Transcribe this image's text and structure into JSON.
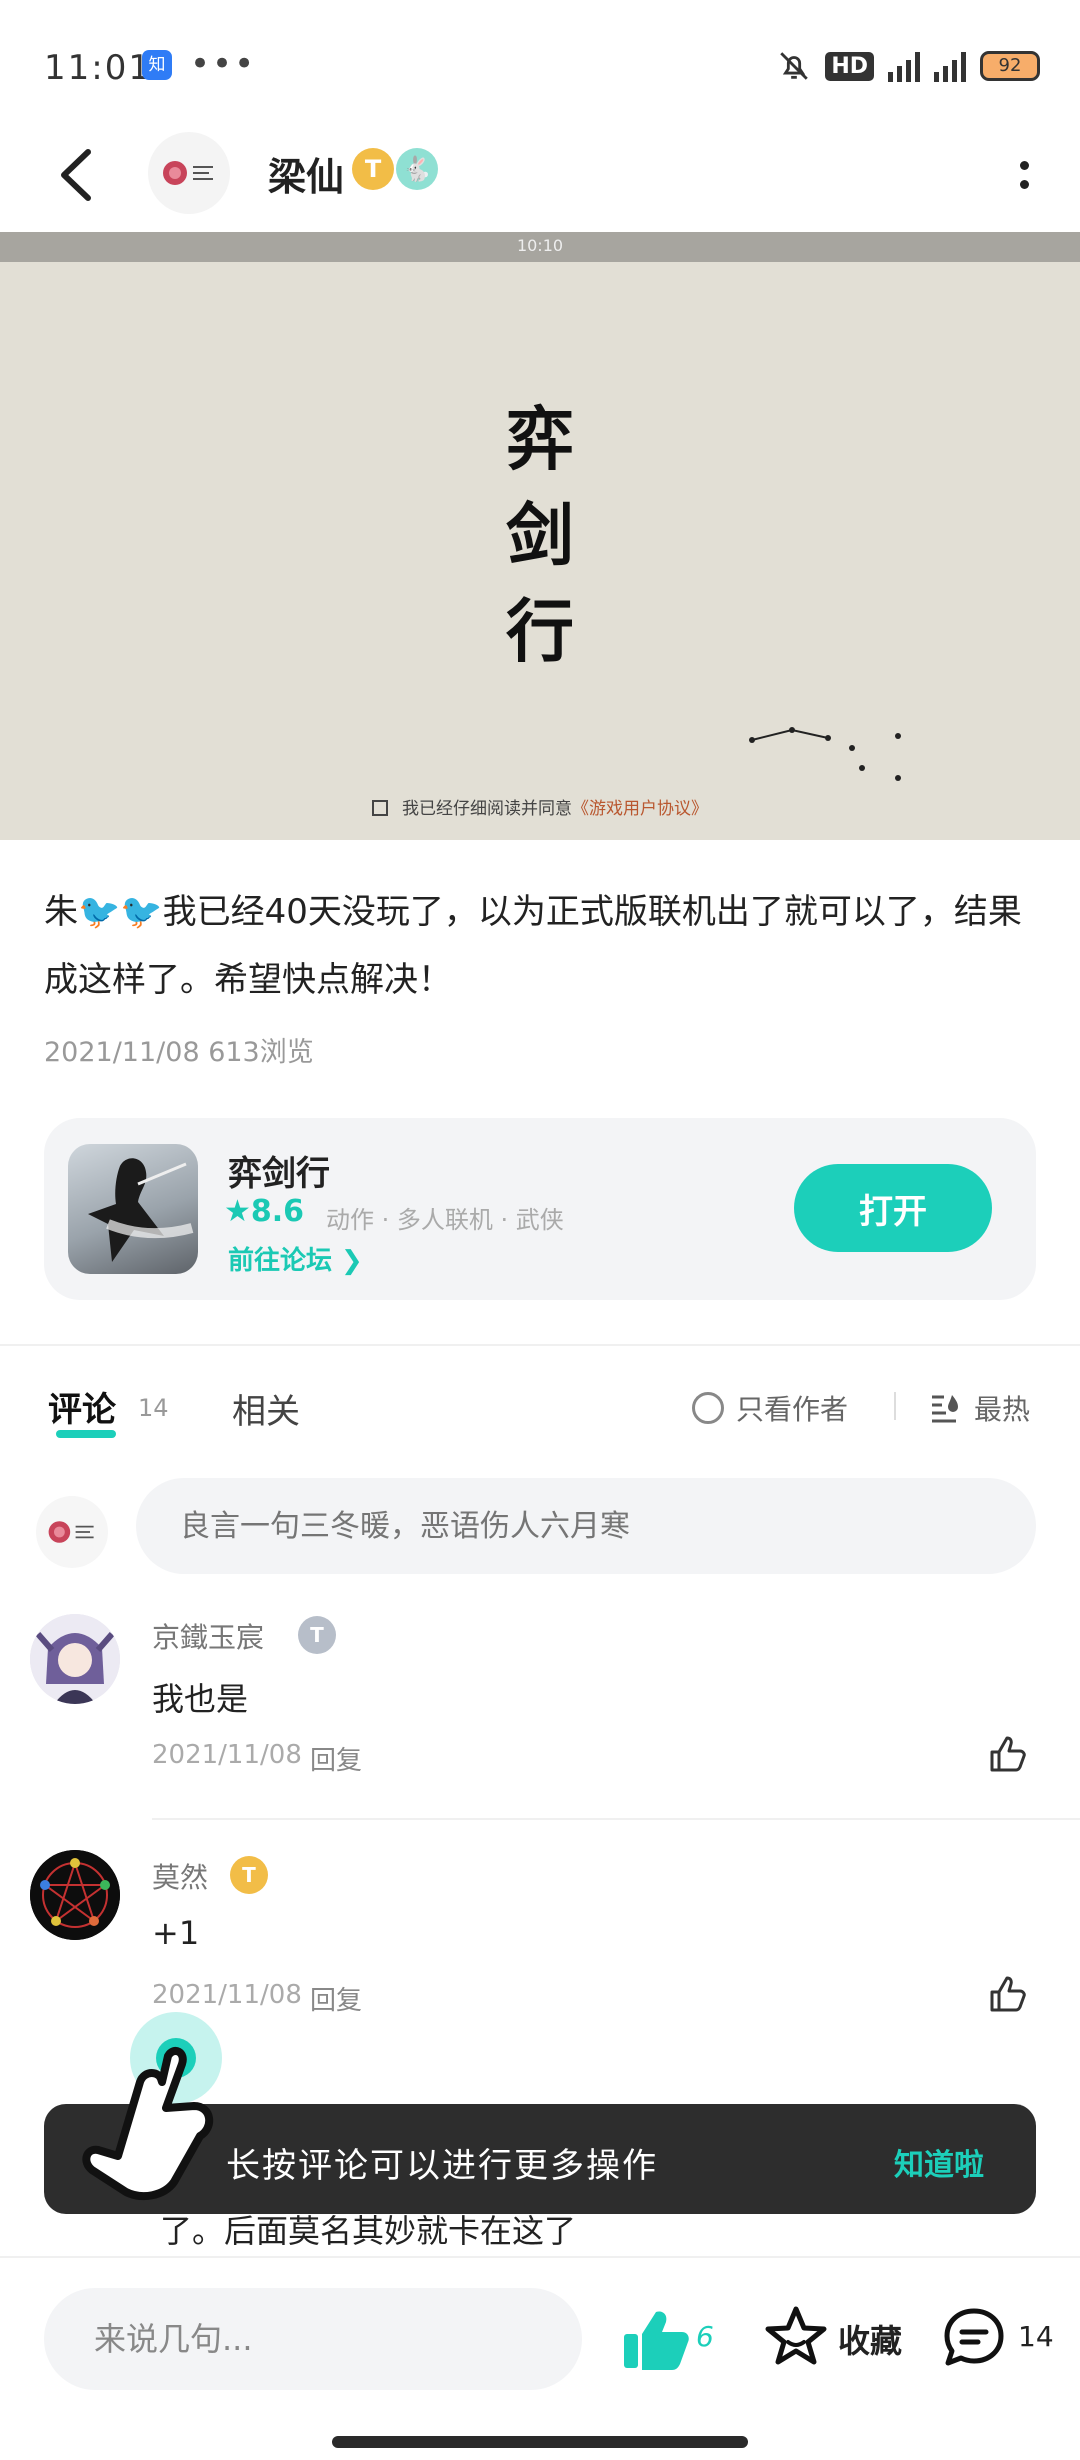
{
  "status_bar": {
    "time": "11:01",
    "app_icon_label": "知",
    "more": "•••",
    "network": "HD",
    "battery": "92"
  },
  "header": {
    "author_name": "梁仙",
    "level_badge": "T",
    "icons": [
      "back-arrow-icon",
      "more-vertical-icon"
    ]
  },
  "post_image": {
    "inner_time": "10:10",
    "game_title_chars": [
      "弈",
      "剑",
      "行"
    ],
    "agree_prefix": "我已经仔细阅读并同意",
    "agree_link": "《游戏用户协议》"
  },
  "post": {
    "text": "朱🐦🐦我已经40天没玩了，以为正式版联机出了就可以了，结果成这样了。希望快点解决！",
    "meta": "2021/11/08 613浏览"
  },
  "game_card": {
    "name": "弈剑行",
    "rating": "★8.6",
    "tags": "动作 · 多人联机 · 武侠",
    "forum_link": "前往论坛 ❯",
    "open_button": "打开"
  },
  "tabs": {
    "comment_label": "评论",
    "comment_count": "14",
    "related_label": "相关",
    "author_only": "只看作者",
    "sort": "最热"
  },
  "comment_input": {
    "placeholder": "良言一句三冬暖，恶语伤人六月寒"
  },
  "comments": [
    {
      "name": "京鐵玉宸",
      "badge": "T",
      "text": "我也是",
      "date": "2021/11/08",
      "reply": "回复"
    },
    {
      "name": "莫然",
      "badge": "T",
      "text": "+1",
      "date": "2021/11/08",
      "reply": "回复"
    }
  ],
  "toast": {
    "text": "长按评论可以进行更多操作",
    "button": "知道啦"
  },
  "partial_comment_text": "了。后面莫名其妙就卡在这了",
  "bottom_bar": {
    "input_placeholder": "来说几句...",
    "like_count": "6",
    "favorite_label": "收藏",
    "comment_count": "14"
  },
  "colors": {
    "accent": "#1ccfba",
    "toast_bg": "#2d2d2d",
    "image_bg": "#e2dfd5",
    "badge_gold": "#f2bd47"
  }
}
